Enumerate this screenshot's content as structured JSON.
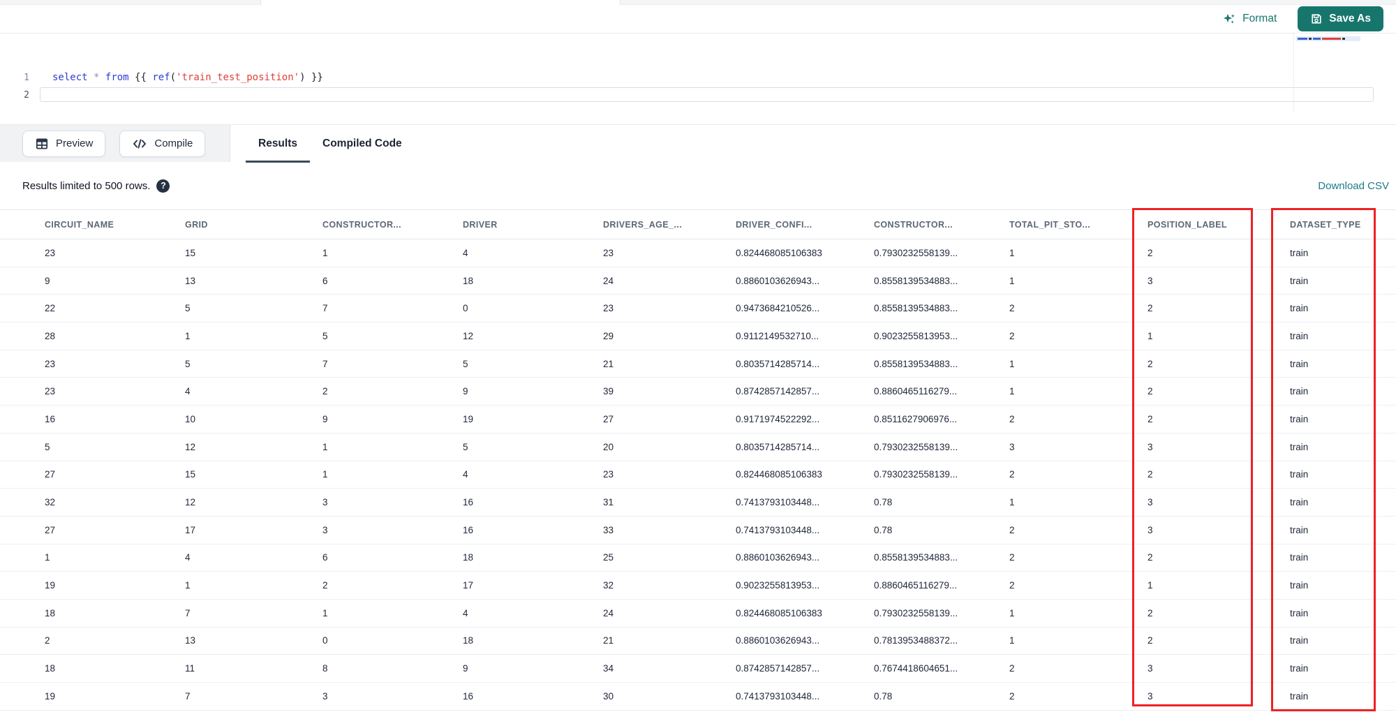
{
  "toolbar": {
    "format_label": "Format",
    "save_as_label": "Save As"
  },
  "editor": {
    "line_numbers": [
      "1",
      "2"
    ],
    "code": {
      "kw_select": "select",
      "star": "*",
      "kw_from": "from",
      "jinja_open": "{{",
      "fn_ref": "ref",
      "paren_open": "(",
      "string_arg": "'train_test_position'",
      "paren_close": ")",
      "jinja_close": "}}"
    }
  },
  "actions": {
    "preview_label": "Preview",
    "compile_label": "Compile"
  },
  "tabs": [
    {
      "label": "Results",
      "active": true
    },
    {
      "label": "Compiled Code",
      "active": false
    }
  ],
  "results_bar": {
    "limit_text": "Results limited to 500 rows.",
    "help_glyph": "?",
    "download_label": "Download CSV"
  },
  "table": {
    "columns": [
      "CIRCUIT_NAME",
      "GRID",
      "CONSTRUCTOR...",
      "DRIVER",
      "DRIVERS_AGE_...",
      "DRIVER_CONFI...",
      "CONSTRUCTOR...",
      "TOTAL_PIT_STO...",
      "POSITION_LABEL",
      "DATASET_TYPE"
    ],
    "rows": [
      [
        "23",
        "15",
        "1",
        "4",
        "23",
        "0.824468085106383",
        "0.7930232558139...",
        "1",
        "2",
        "train"
      ],
      [
        "9",
        "13",
        "6",
        "18",
        "24",
        "0.8860103626943...",
        "0.8558139534883...",
        "1",
        "3",
        "train"
      ],
      [
        "22",
        "5",
        "7",
        "0",
        "23",
        "0.9473684210526...",
        "0.8558139534883...",
        "2",
        "2",
        "train"
      ],
      [
        "28",
        "1",
        "5",
        "12",
        "29",
        "0.9112149532710...",
        "0.9023255813953...",
        "2",
        "1",
        "train"
      ],
      [
        "23",
        "5",
        "7",
        "5",
        "21",
        "0.8035714285714...",
        "0.8558139534883...",
        "1",
        "2",
        "train"
      ],
      [
        "23",
        "4",
        "2",
        "9",
        "39",
        "0.8742857142857...",
        "0.8860465116279...",
        "1",
        "2",
        "train"
      ],
      [
        "16",
        "10",
        "9",
        "19",
        "27",
        "0.9171974522292...",
        "0.8511627906976...",
        "2",
        "2",
        "train"
      ],
      [
        "5",
        "12",
        "1",
        "5",
        "20",
        "0.8035714285714...",
        "0.7930232558139...",
        "3",
        "3",
        "train"
      ],
      [
        "27",
        "15",
        "1",
        "4",
        "23",
        "0.824468085106383",
        "0.7930232558139...",
        "2",
        "2",
        "train"
      ],
      [
        "32",
        "12",
        "3",
        "16",
        "31",
        "0.7413793103448...",
        "0.78",
        "1",
        "3",
        "train"
      ],
      [
        "27",
        "17",
        "3",
        "16",
        "33",
        "0.7413793103448...",
        "0.78",
        "2",
        "3",
        "train"
      ],
      [
        "1",
        "4",
        "6",
        "18",
        "25",
        "0.8860103626943...",
        "0.8558139534883...",
        "2",
        "2",
        "train"
      ],
      [
        "19",
        "1",
        "2",
        "17",
        "32",
        "0.9023255813953...",
        "0.8860465116279...",
        "2",
        "1",
        "train"
      ],
      [
        "18",
        "7",
        "1",
        "4",
        "24",
        "0.824468085106383",
        "0.7930232558139...",
        "1",
        "2",
        "train"
      ],
      [
        "2",
        "13",
        "0",
        "18",
        "21",
        "0.8860103626943...",
        "0.7813953488372...",
        "1",
        "2",
        "train"
      ],
      [
        "18",
        "11",
        "8",
        "9",
        "34",
        "0.8742857142857...",
        "0.7674418604651...",
        "2",
        "3",
        "train"
      ],
      [
        "19",
        "7",
        "3",
        "16",
        "30",
        "0.7413793103448...",
        "0.78",
        "2",
        "3",
        "train"
      ]
    ],
    "highlighted_columns": [
      "POSITION_LABEL",
      "DATASET_TYPE"
    ]
  },
  "colors": {
    "accent_teal": "#17766C",
    "link_teal": "#1E7A8E",
    "highlight_red": "#EE2125",
    "tab_underline": "#3C485A"
  }
}
